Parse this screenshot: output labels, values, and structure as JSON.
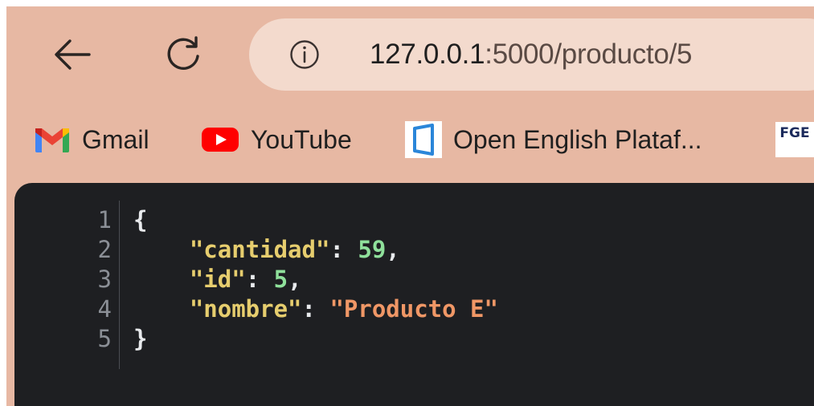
{
  "address_bar": {
    "host": "127.0.0.1",
    "rest": ":5000/producto/5"
  },
  "bookmarks": [
    {
      "label": "Gmail",
      "icon": "gmail-icon"
    },
    {
      "label": "YouTube",
      "icon": "youtube-icon"
    },
    {
      "label": "Open English Plataf...",
      "icon": "open-english-icon"
    },
    {
      "label": "FGE",
      "icon": "fge-icon"
    }
  ],
  "json_view": {
    "line_numbers": [
      "1",
      "2",
      "3",
      "4",
      "5"
    ],
    "open_brace": "{",
    "close_brace": "}",
    "entries": [
      {
        "key": "\"cantidad\"",
        "value": "59",
        "value_type": "number",
        "trail": ","
      },
      {
        "key": "\"id\"",
        "value": "5",
        "value_type": "number",
        "trail": ","
      },
      {
        "key": "\"nombre\"",
        "value": "\"Producto E\"",
        "value_type": "string",
        "trail": ""
      }
    ]
  },
  "colors": {
    "frame": "#e7b8a3",
    "omnibox": "#f3dacd",
    "viewer_bg": "#1e1f22",
    "json_key": "#e6cd6e",
    "json_number": "#8fe09b",
    "json_string": "#f09766"
  }
}
